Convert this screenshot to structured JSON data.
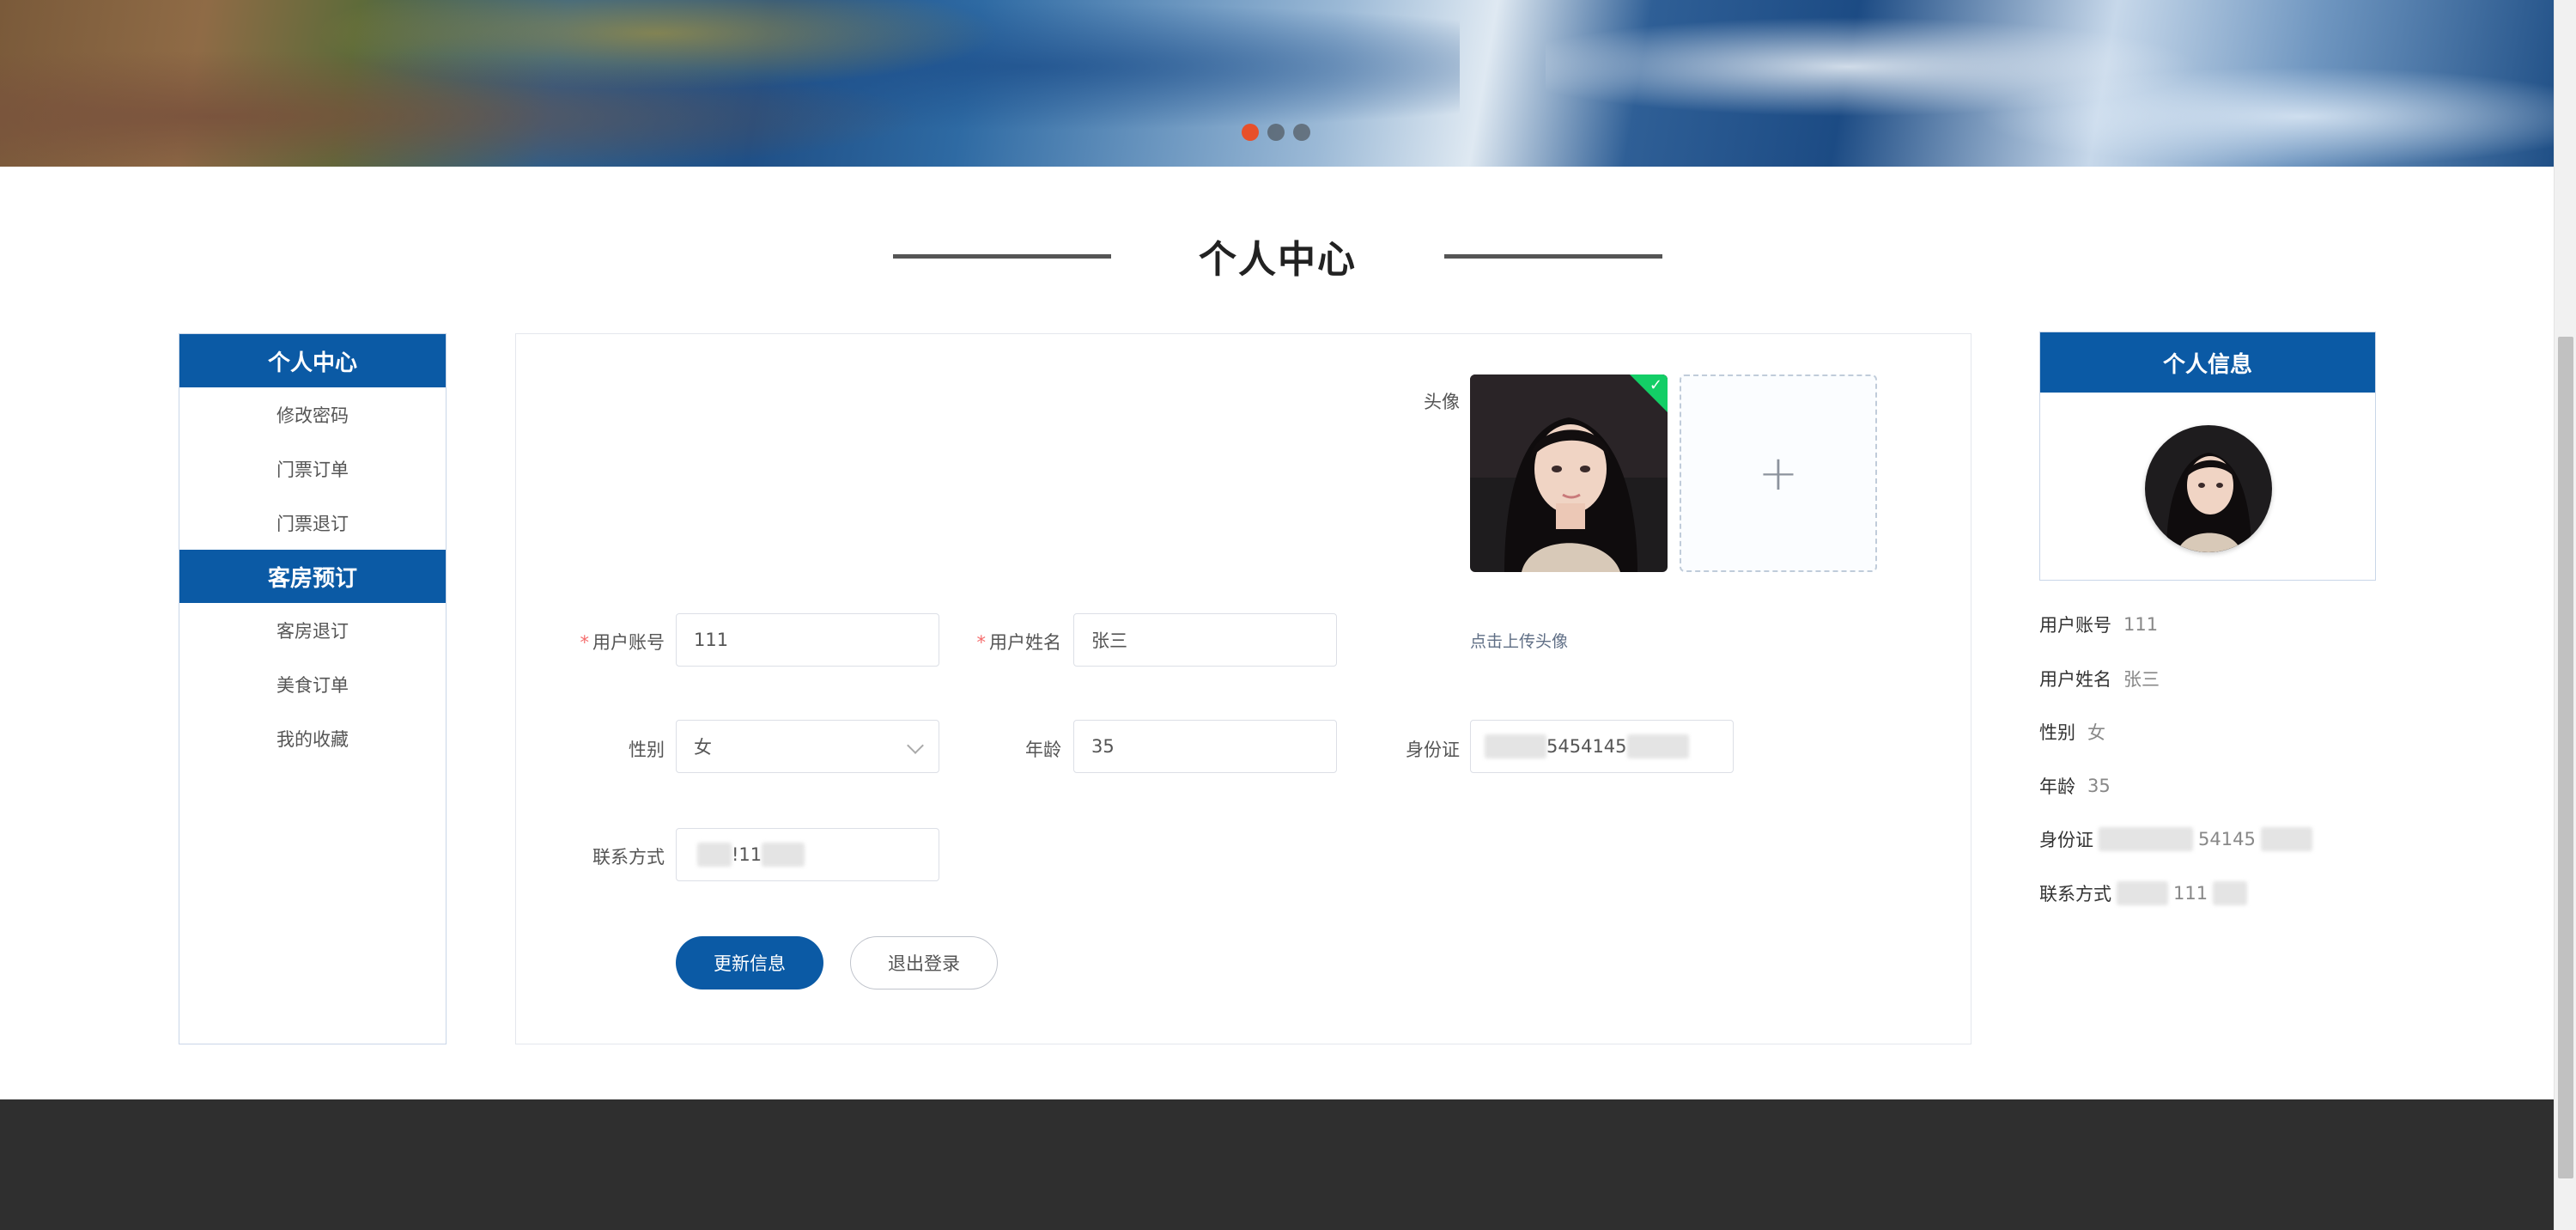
{
  "banner": {
    "dots": 3,
    "active_dot": 1
  },
  "section": {
    "title": "个人中心"
  },
  "left_menu": {
    "groups": [
      {
        "title": "个人中心",
        "items": [
          "修改密码",
          "门票订单",
          "门票退订"
        ]
      },
      {
        "title": "客房预订",
        "items": [
          "客房退订",
          "美食订单",
          "我的收藏"
        ]
      }
    ]
  },
  "form": {
    "avatar_label": "头像",
    "upload_icon": "+",
    "upload_tip": "点击上传头像",
    "account_label": "用户账号",
    "account_value": "111",
    "name_label": "用户姓名",
    "name_value": "张三",
    "gender_label": "性别",
    "gender_value": "女",
    "age_label": "年龄",
    "age_value": "35",
    "id_label": "身份证",
    "id_visible": "5454145",
    "contact_label": "联系方式",
    "contact_visible": "!11",
    "required_mark": "*",
    "check_mark": "✓",
    "update_button": "更新信息",
    "logout_button": "退出登录"
  },
  "profile": {
    "title": "个人信息",
    "rows": [
      {
        "label": "用户账号",
        "value": "111"
      },
      {
        "label": "用户姓名",
        "value": "张三"
      },
      {
        "label": "性别",
        "value": "女"
      },
      {
        "label": "年龄",
        "value": "35"
      },
      {
        "label": "身份证",
        "value": "54145"
      },
      {
        "label": "联系方式",
        "value": "111"
      }
    ]
  },
  "colors": {
    "primary": "#0b5aa5",
    "footer": "#2f2f2f",
    "accent_dot": "#e8502a"
  }
}
